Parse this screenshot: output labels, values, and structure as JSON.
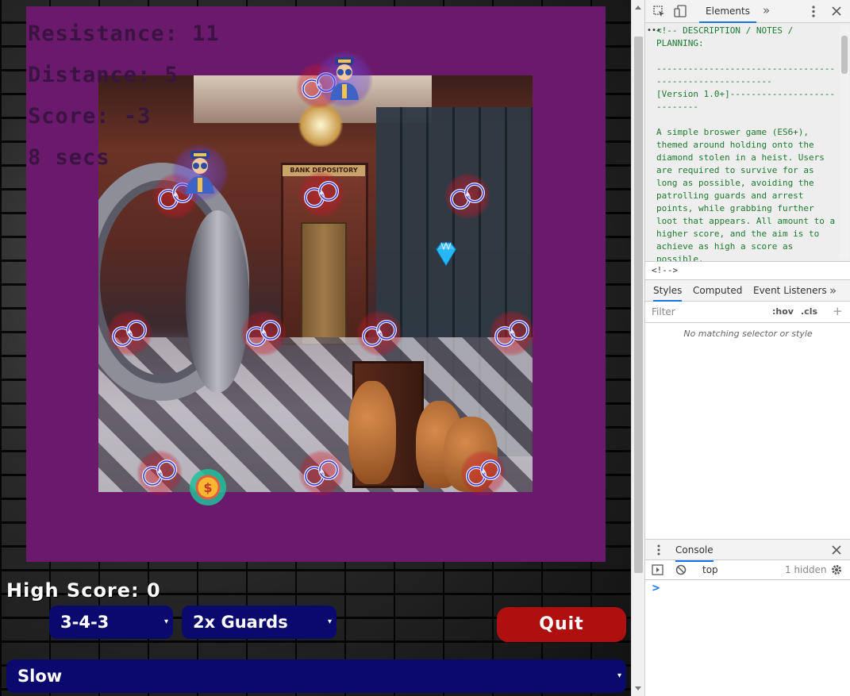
{
  "game": {
    "hud": {
      "resistance": "Resistance: 11",
      "distance": "Distance: 5",
      "score": "Score: -3",
      "timer": "8 secs"
    },
    "scene_sign": "BANK DEPOSITORY",
    "high_score": "High Score: 0",
    "controls": {
      "formation_value": "3-4-3",
      "guards_value": "2x Guards",
      "speed_value": "Slow",
      "quit_label": "Quit",
      "caret": "▾"
    },
    "colors": {
      "board": "#6b1a6b",
      "select_bg": "#0a0a6e",
      "quit_bg": "#b00f0f"
    }
  },
  "devtools": {
    "elements_tab": "Elements",
    "more_tabs": "»",
    "code_lines": "<!-- DESCRIPTION / NOTES / PLANNING:\n\n--------------------------------------------------------\n[Version 1.0+]----------------------------\n\nA simple broswer game (ES6+), themed around holding onto the diamond stolen in a heist. Users are required to survive for as long as possible, avoiding the patrolling guards and arrest points, while grabbing further loot that appears. All amount to a higher score, and the aim is to achieve as high a score as possible.",
    "breadcrumb": "<!-->",
    "styles_tabs": [
      "Styles",
      "Computed",
      "Event Listeners"
    ],
    "filter_placeholder": "Filter",
    "hov": ":hov",
    "cls": ".cls",
    "plus": "+",
    "no_match": "No matching selector or style",
    "console_tab": "Console",
    "console_context": "top",
    "console_hidden": "1 hidden",
    "prompt": ">"
  }
}
